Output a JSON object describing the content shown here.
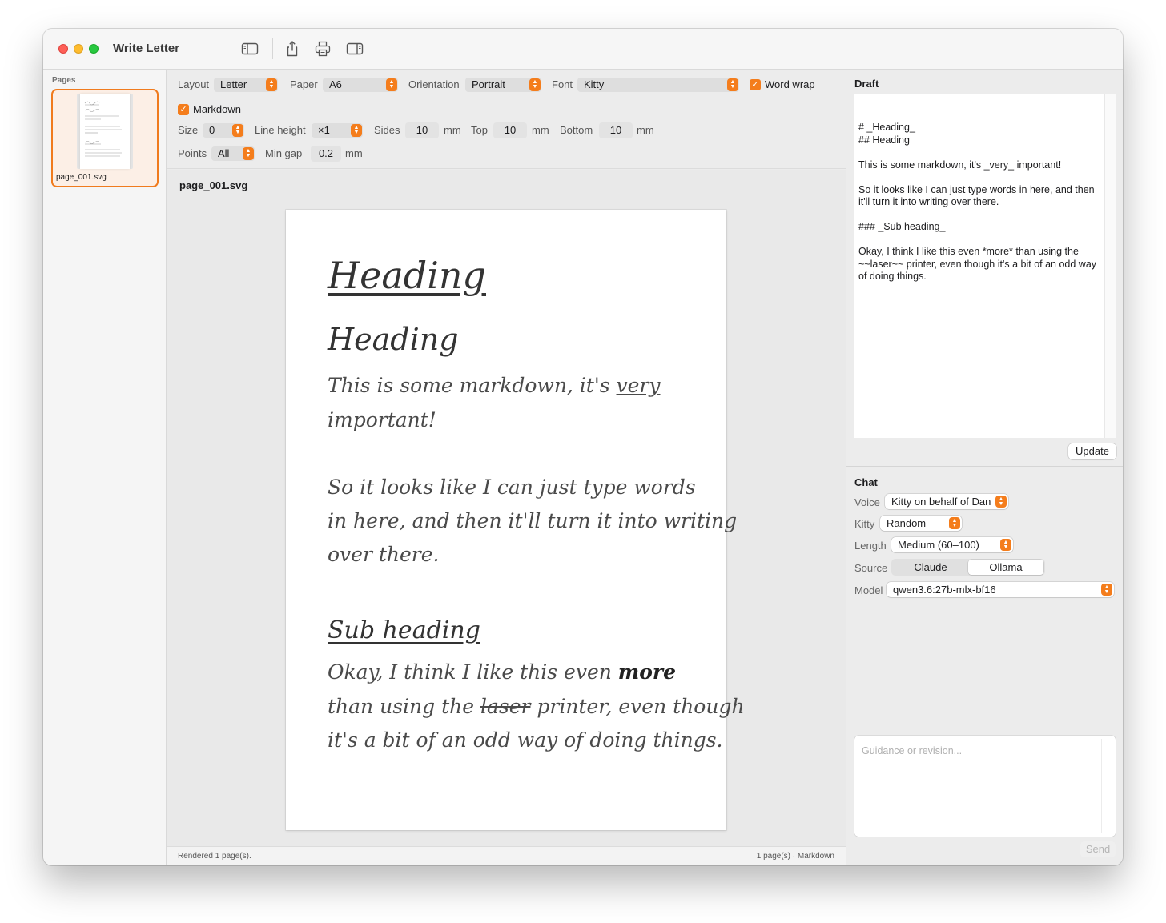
{
  "window": {
    "title": "Write Letter"
  },
  "toolbar": {
    "icons": [
      "sidebar-toggle-icon",
      "share-icon",
      "print-icon",
      "inspector-toggle-icon"
    ]
  },
  "sidebar": {
    "label": "Pages",
    "pages": [
      {
        "name": "page_001.svg"
      }
    ]
  },
  "controls": {
    "layout": {
      "label": "Layout",
      "value": "Letter"
    },
    "paper": {
      "label": "Paper",
      "value": "A6"
    },
    "orientation": {
      "label": "Orientation",
      "value": "Portrait"
    },
    "font": {
      "label": "Font",
      "value": "Kitty"
    },
    "word_wrap": {
      "label": "Word wrap",
      "checked": true
    },
    "markdown": {
      "label": "Markdown",
      "checked": true
    },
    "size": {
      "label": "Size",
      "value": "0"
    },
    "line_height": {
      "label": "Line height",
      "value": "×1"
    },
    "sides": {
      "label": "Sides",
      "value": "10",
      "unit": "mm"
    },
    "top": {
      "label": "Top",
      "value": "10",
      "unit": "mm"
    },
    "bottom": {
      "label": "Bottom",
      "value": "10",
      "unit": "mm"
    },
    "points": {
      "label": "Points",
      "value": "All"
    },
    "min_gap": {
      "label": "Min gap",
      "value": "0.2",
      "unit": "mm"
    }
  },
  "preview": {
    "title": "page_001.svg",
    "handwriting": {
      "h1": "Heading",
      "h2": "Heading",
      "p1_line1_a": "This is some markdown, it's ",
      "p1_line1_b": "very",
      "p1_line2": "important!",
      "p2_line1": "So it looks like I can just type words",
      "p2_line2": "in here, and then it'll turn it into writing",
      "p2_line3": "over there.",
      "h3": "Sub heading",
      "p3_line1_a": "Okay, I think I like this even ",
      "p3_line1_b": "more",
      "p3_line2_a": "than using the ",
      "p3_line2_b": "laser",
      "p3_line2_c": " printer, even though",
      "p3_line3": "it's a bit of an odd way of doing things."
    }
  },
  "status": {
    "left": "Rendered 1 page(s).",
    "right": "1 page(s) · Markdown"
  },
  "draft": {
    "title": "Draft",
    "text": "# _Heading_\n## Heading\n\nThis is some markdown, it's _very_ important!\n\nSo it looks like I can just type words in here, and then it'll turn it into writing over there.\n\n### _Sub heading_\n\nOkay, I think I like this even *more* than using the ~~laser~~ printer, even though it's a bit of an odd way of doing things.",
    "update_label": "Update"
  },
  "chat": {
    "title": "Chat",
    "voice": {
      "label": "Voice",
      "value": "Kitty on behalf of Dan"
    },
    "kitty": {
      "label": "Kitty",
      "value": "Random"
    },
    "length": {
      "label": "Length",
      "value": "Medium (60–100)"
    },
    "source": {
      "label": "Source",
      "options": [
        "Claude",
        "Ollama"
      ],
      "selected": "Ollama"
    },
    "model": {
      "label": "Model",
      "value": "qwen3.6:27b-mlx-bf16"
    },
    "input_placeholder": "Guidance or revision...",
    "send_label": "Send"
  },
  "colors": {
    "accent": "#f47d1c",
    "selection_border": "#f07b1e"
  }
}
